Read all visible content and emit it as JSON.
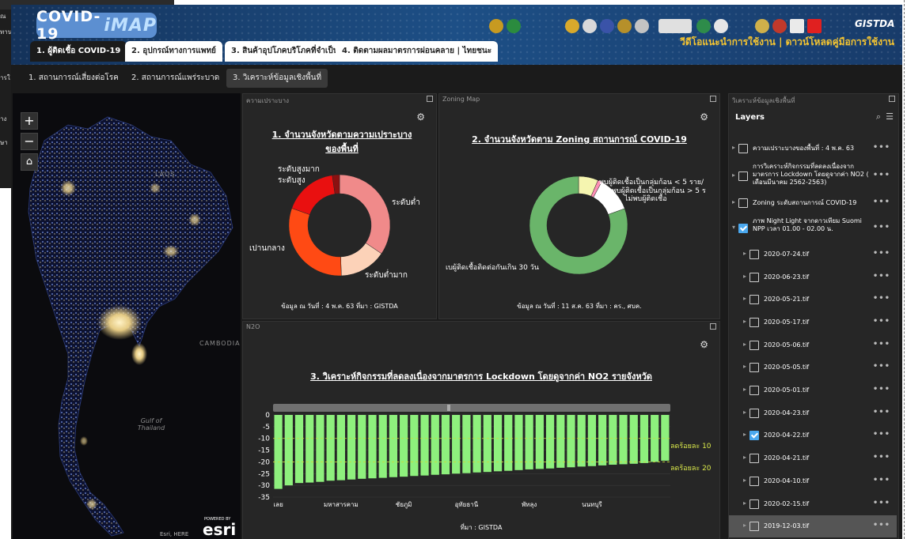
{
  "background_window": {
    "lines": [
      "ณ",
      "ทาน",
      "ารใ",
      "าง",
      "ษา"
    ]
  },
  "header": {
    "app_title": "COVID-19",
    "app_title_i": "iMAP",
    "links": "วีดีโอแนะนำการใช้งาน | ดาวน์โหลดคู่มือการใช้งาน",
    "brand": "GISTDA",
    "colors": {
      "gradient_left": "#14325a",
      "gradient_mid": "#1d4f86",
      "accent_yellow": "#f4c431"
    }
  },
  "tabs": [
    {
      "label": "1. ผู้ติดเชื้อ COVID-19",
      "active": true
    },
    {
      "label": "2. อุปกรณ์ทางการแพทย์",
      "active": false
    },
    {
      "label": "3. สินค้าอุปโภคบริโภคที่จำเป็น",
      "active": false
    },
    {
      "label": "4. ติดตามผลมาตรการผ่อนคลาย | ไทยชนะ",
      "active": false
    }
  ],
  "subtabs": [
    {
      "label": "1. สถานการณ์เสี่ยงต่อโรค",
      "active": false
    },
    {
      "label": "2. สถานการณ์แพร่ระบาด",
      "active": false
    },
    {
      "label": "3. วิเคราะห์ข้อมูลเชิงพื้นที่",
      "active": true
    }
  ],
  "map": {
    "zoom_in": "+",
    "zoom_out": "−",
    "home_icon": "home-icon",
    "labels": {
      "laos": "LAOS",
      "cambodia": "CAMBODIA",
      "gulf": "Gulf of Thailand"
    },
    "attribution": "Esri, HERE",
    "powered_by": "POWERED BY",
    "esri": "esri"
  },
  "panel_vulnerability": {
    "header": "ความเปราะบาง",
    "title": "1. จำนวนจังหวัดตามความเปราะบางของพื้นที่",
    "note": "ข้อมูล ณ วันที่ : 4 พ.ค. 63  ที่มา : GISTDA",
    "labels": [
      "ระดับสูงมาก",
      "ระดับสูง",
      "ระดับต่ำ",
      "เปานกลาง",
      "ระดับต่ำมาก"
    ]
  },
  "panel_zoning": {
    "header": "Zoning Map",
    "title": "2. จำนวนจังหวัดตาม Zoning สถานการณ์ COVID-19",
    "note": "ข้อมูล ณ วันที่ : 11 ส.ค. 63  ที่มา : คร., ศบค.",
    "labels": [
      "พบผู้ติดเชื้อเป็นกลุ่มก้อน < 5 ราย/",
      "พบผู้ติดเชื้อเป็นกลุ่มก้อน > 5 ร",
      "ไม่พบผู้ติดเชื้อ",
      "เบผู้ติดเชื้อติดต่อกันเกิน 30 วัน"
    ]
  },
  "panel_no2": {
    "header": "N2O",
    "title": "3. วิเคราะห์กิจกรรมที่ลดลงเนื่องจากมาตรการ Lockdown โดยดูจากค่า NO2 รายจังหวัด",
    "source": "ที่มา : GISTDA",
    "ref_labels": [
      "ลดร้อยละ 10",
      "ลดร้อยละ 20"
    ]
  },
  "chart_data": [
    {
      "type": "pie",
      "title": "1. จำนวนจังหวัดตามความเปราะบางของพื้นที่",
      "categories": [
        "ระดับต่ำ",
        "ระดับต่ำมาก",
        "เปานกลาง",
        "ระดับสูง",
        "ระดับสูงมาก"
      ],
      "values": [
        30,
        13,
        27,
        15,
        2
      ],
      "colors": [
        "#f08a8a",
        "#fcd2b8",
        "#ff4a14",
        "#e91010",
        "#8b1111"
      ]
    },
    {
      "type": "pie",
      "title": "2. จำนวนจังหวัดตาม Zoning สถานการณ์ COVID-19",
      "categories": [
        "พบผู้ติดเชื้อเป็นกลุ่มก้อน < 5 ราย/",
        "พบผู้ติดเชื้อเป็นกลุ่มก้อน > 5 ร",
        "ไม่พบผู้ติดเชื้อ",
        "เบผู้ติดเชื้อติดต่อกันเกิน 30 วัน"
      ],
      "values": [
        5,
        1,
        9,
        62
      ],
      "colors": [
        "#f5f5b0",
        "#ff8fb5",
        "#ffffff",
        "#6ab56a"
      ]
    },
    {
      "type": "bar",
      "title": "3. วิเคราะห์กิจกรรมที่ลดลงเนื่องจากมาตรการ Lockdown โดยดูจากค่า NO2 รายจังหวัด",
      "ylim": [
        -35,
        0
      ],
      "yticks": [
        0,
        -5,
        -10,
        -15,
        -20,
        -25,
        -30,
        -35
      ],
      "xtick_labels": [
        "เลย",
        "มหาสารคาม",
        "ชัยภูมิ",
        "อุทัยธานี",
        "พัทลุง",
        "นนทบุรี"
      ],
      "xtick_index": [
        0,
        6,
        12,
        18,
        24,
        30
      ],
      "reference_lines": [
        -10,
        -20
      ],
      "values": [
        -31.5,
        -30,
        -29,
        -28.8,
        -28.5,
        -28,
        -27.8,
        -27.5,
        -27.2,
        -27,
        -26.8,
        -26.5,
        -26.3,
        -26,
        -25.8,
        -25.5,
        -25.3,
        -25,
        -24.8,
        -24.5,
        -24.3,
        -24,
        -23.8,
        -23.5,
        -23.2,
        -23,
        -22.8,
        -22.5,
        -22.3,
        -22,
        -21.8,
        -21.5,
        -21.2,
        -21,
        -20.8,
        -20.5,
        -20,
        -19.5
      ],
      "bar_color": "#8ef07d"
    }
  ],
  "layers": {
    "header": "วิเคราะห์ข้อมูลเชิงพื้นที่",
    "title": "Layers",
    "search_icon": "search-icon",
    "filter_icon": "filter-icon",
    "items": [
      {
        "label": "ความเปราะบางของพื้นที่ : 4 พ.ค. 63",
        "checked": false,
        "expanded": false,
        "level": 0
      },
      {
        "label": "การวิเคราะห์กิจกรรมที่ลดลงเนื่องจากมาตรการ Lockdown โดยดูจากค่า NO2 ( เดือนมีนาคม 2562-2563)",
        "checked": false,
        "expanded": false,
        "level": 0
      },
      {
        "label": "Zoning ระดับสถานการณ์ COVID-19",
        "checked": false,
        "expanded": false,
        "level": 0
      },
      {
        "label": "ภาพ Night Light จากดาวเทียม Suomi NPP เวลา 01.00 - 02.00 น.",
        "checked": true,
        "expanded": true,
        "level": 0
      },
      {
        "label": "2020-07-24.tif",
        "checked": false,
        "level": 1
      },
      {
        "label": "2020-06-23.tif",
        "checked": false,
        "level": 1
      },
      {
        "label": "2020-05-21.tif",
        "checked": false,
        "level": 1
      },
      {
        "label": "2020-05-17.tif",
        "checked": false,
        "level": 1
      },
      {
        "label": "2020-05-06.tif",
        "checked": false,
        "level": 1
      },
      {
        "label": "2020-05-05.tif",
        "checked": false,
        "level": 1
      },
      {
        "label": "2020-05-01.tif",
        "checked": false,
        "level": 1
      },
      {
        "label": "2020-04-23.tif",
        "checked": false,
        "level": 1
      },
      {
        "label": "2020-04-22.tif",
        "checked": true,
        "level": 1
      },
      {
        "label": "2020-04-21.tif",
        "checked": false,
        "level": 1
      },
      {
        "label": "2020-04-10.tif",
        "checked": false,
        "level": 1
      },
      {
        "label": "2020-02-15.tif",
        "checked": false,
        "level": 1
      },
      {
        "label": "2019-12-03.tif",
        "checked": false,
        "level": 1,
        "selected": true
      }
    ]
  }
}
